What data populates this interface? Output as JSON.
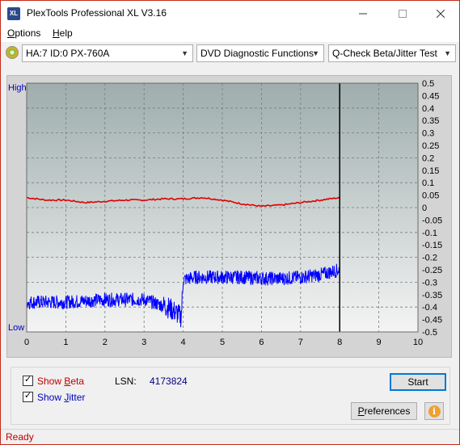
{
  "window": {
    "title": "PlexTools Professional XL V3.16",
    "icon_text": "XL"
  },
  "menu": {
    "items": [
      {
        "label": "Options",
        "accel": "O",
        "rest": "ptions"
      },
      {
        "label": "Help",
        "accel": "H",
        "rest": "elp"
      }
    ]
  },
  "toolbar": {
    "drive": "HA:7 ID:0  PX-760A",
    "function": "DVD Diagnostic Functions",
    "test": "Q-Check Beta/Jitter Test"
  },
  "chart_data": {
    "type": "line",
    "x": {
      "min": 0,
      "max": 10,
      "ticks": [
        "0",
        "1",
        "2",
        "3",
        "4",
        "5",
        "6",
        "7",
        "8",
        "9",
        "10"
      ]
    },
    "y_right": {
      "min": -0.5,
      "max": 0.5,
      "ticks": [
        "0.5",
        "0.45",
        "0.4",
        "0.35",
        "0.3",
        "0.25",
        "0.2",
        "0.15",
        "0.1",
        "0.05",
        "0",
        "-0.05",
        "-0.1",
        "-0.15",
        "-0.2",
        "-0.25",
        "-0.3",
        "-0.35",
        "-0.4",
        "-0.45",
        "-0.5"
      ]
    },
    "y_left": {
      "top_label": "High",
      "bottom_label": "Low"
    },
    "end_marker_x": 8,
    "grid": true,
    "series": [
      {
        "id": "beta",
        "color": "#e00000",
        "x": [
          0,
          0.5,
          1,
          1.5,
          2,
          2.5,
          3,
          3.5,
          4,
          4.5,
          5,
          5.5,
          6,
          6.5,
          7,
          7.5,
          8
        ],
        "y": [
          0.04,
          0.03,
          0.03,
          0.02,
          0.025,
          0.03,
          0.03,
          0.035,
          0.035,
          0.04,
          0.03,
          0.015,
          0.005,
          0.01,
          0.02,
          0.03,
          0.04
        ]
      },
      {
        "id": "jitter",
        "color": "#0000ff",
        "x": [
          0,
          0.5,
          1,
          1.5,
          2,
          2.5,
          3,
          3.3,
          3.6,
          3.8,
          3.95,
          4.0,
          4.3,
          4.6,
          5,
          5.5,
          6,
          6.5,
          7,
          7.5,
          8
        ],
        "y": [
          -0.38,
          -0.38,
          -0.38,
          -0.375,
          -0.37,
          -0.37,
          -0.37,
          -0.385,
          -0.4,
          -0.42,
          -0.44,
          -0.29,
          -0.28,
          -0.28,
          -0.28,
          -0.28,
          -0.285,
          -0.285,
          -0.28,
          -0.27,
          -0.25
        ]
      }
    ],
    "colors": {
      "plot_bg_top": "#9eadad",
      "plot_bg_bottom": "#f4f4f4",
      "frame_bg": "#d4d4d4",
      "grid": "#7a7a7a"
    }
  },
  "panel": {
    "show_beta": {
      "label": "Show Beta",
      "pre": "Show ",
      "accel": "B",
      "rest": "eta",
      "checked": true,
      "color": "#c00000"
    },
    "show_jitter": {
      "label": "Show Jitter",
      "pre": "Show ",
      "accel": "J",
      "rest": "itter",
      "checked": true,
      "color": "#0000c0"
    },
    "lsn_label": "LSN:",
    "lsn_value": "4173824",
    "start_button": "Start",
    "preferences_button": "Preferences",
    "info_icon": "i"
  },
  "status": {
    "text": "Ready"
  }
}
